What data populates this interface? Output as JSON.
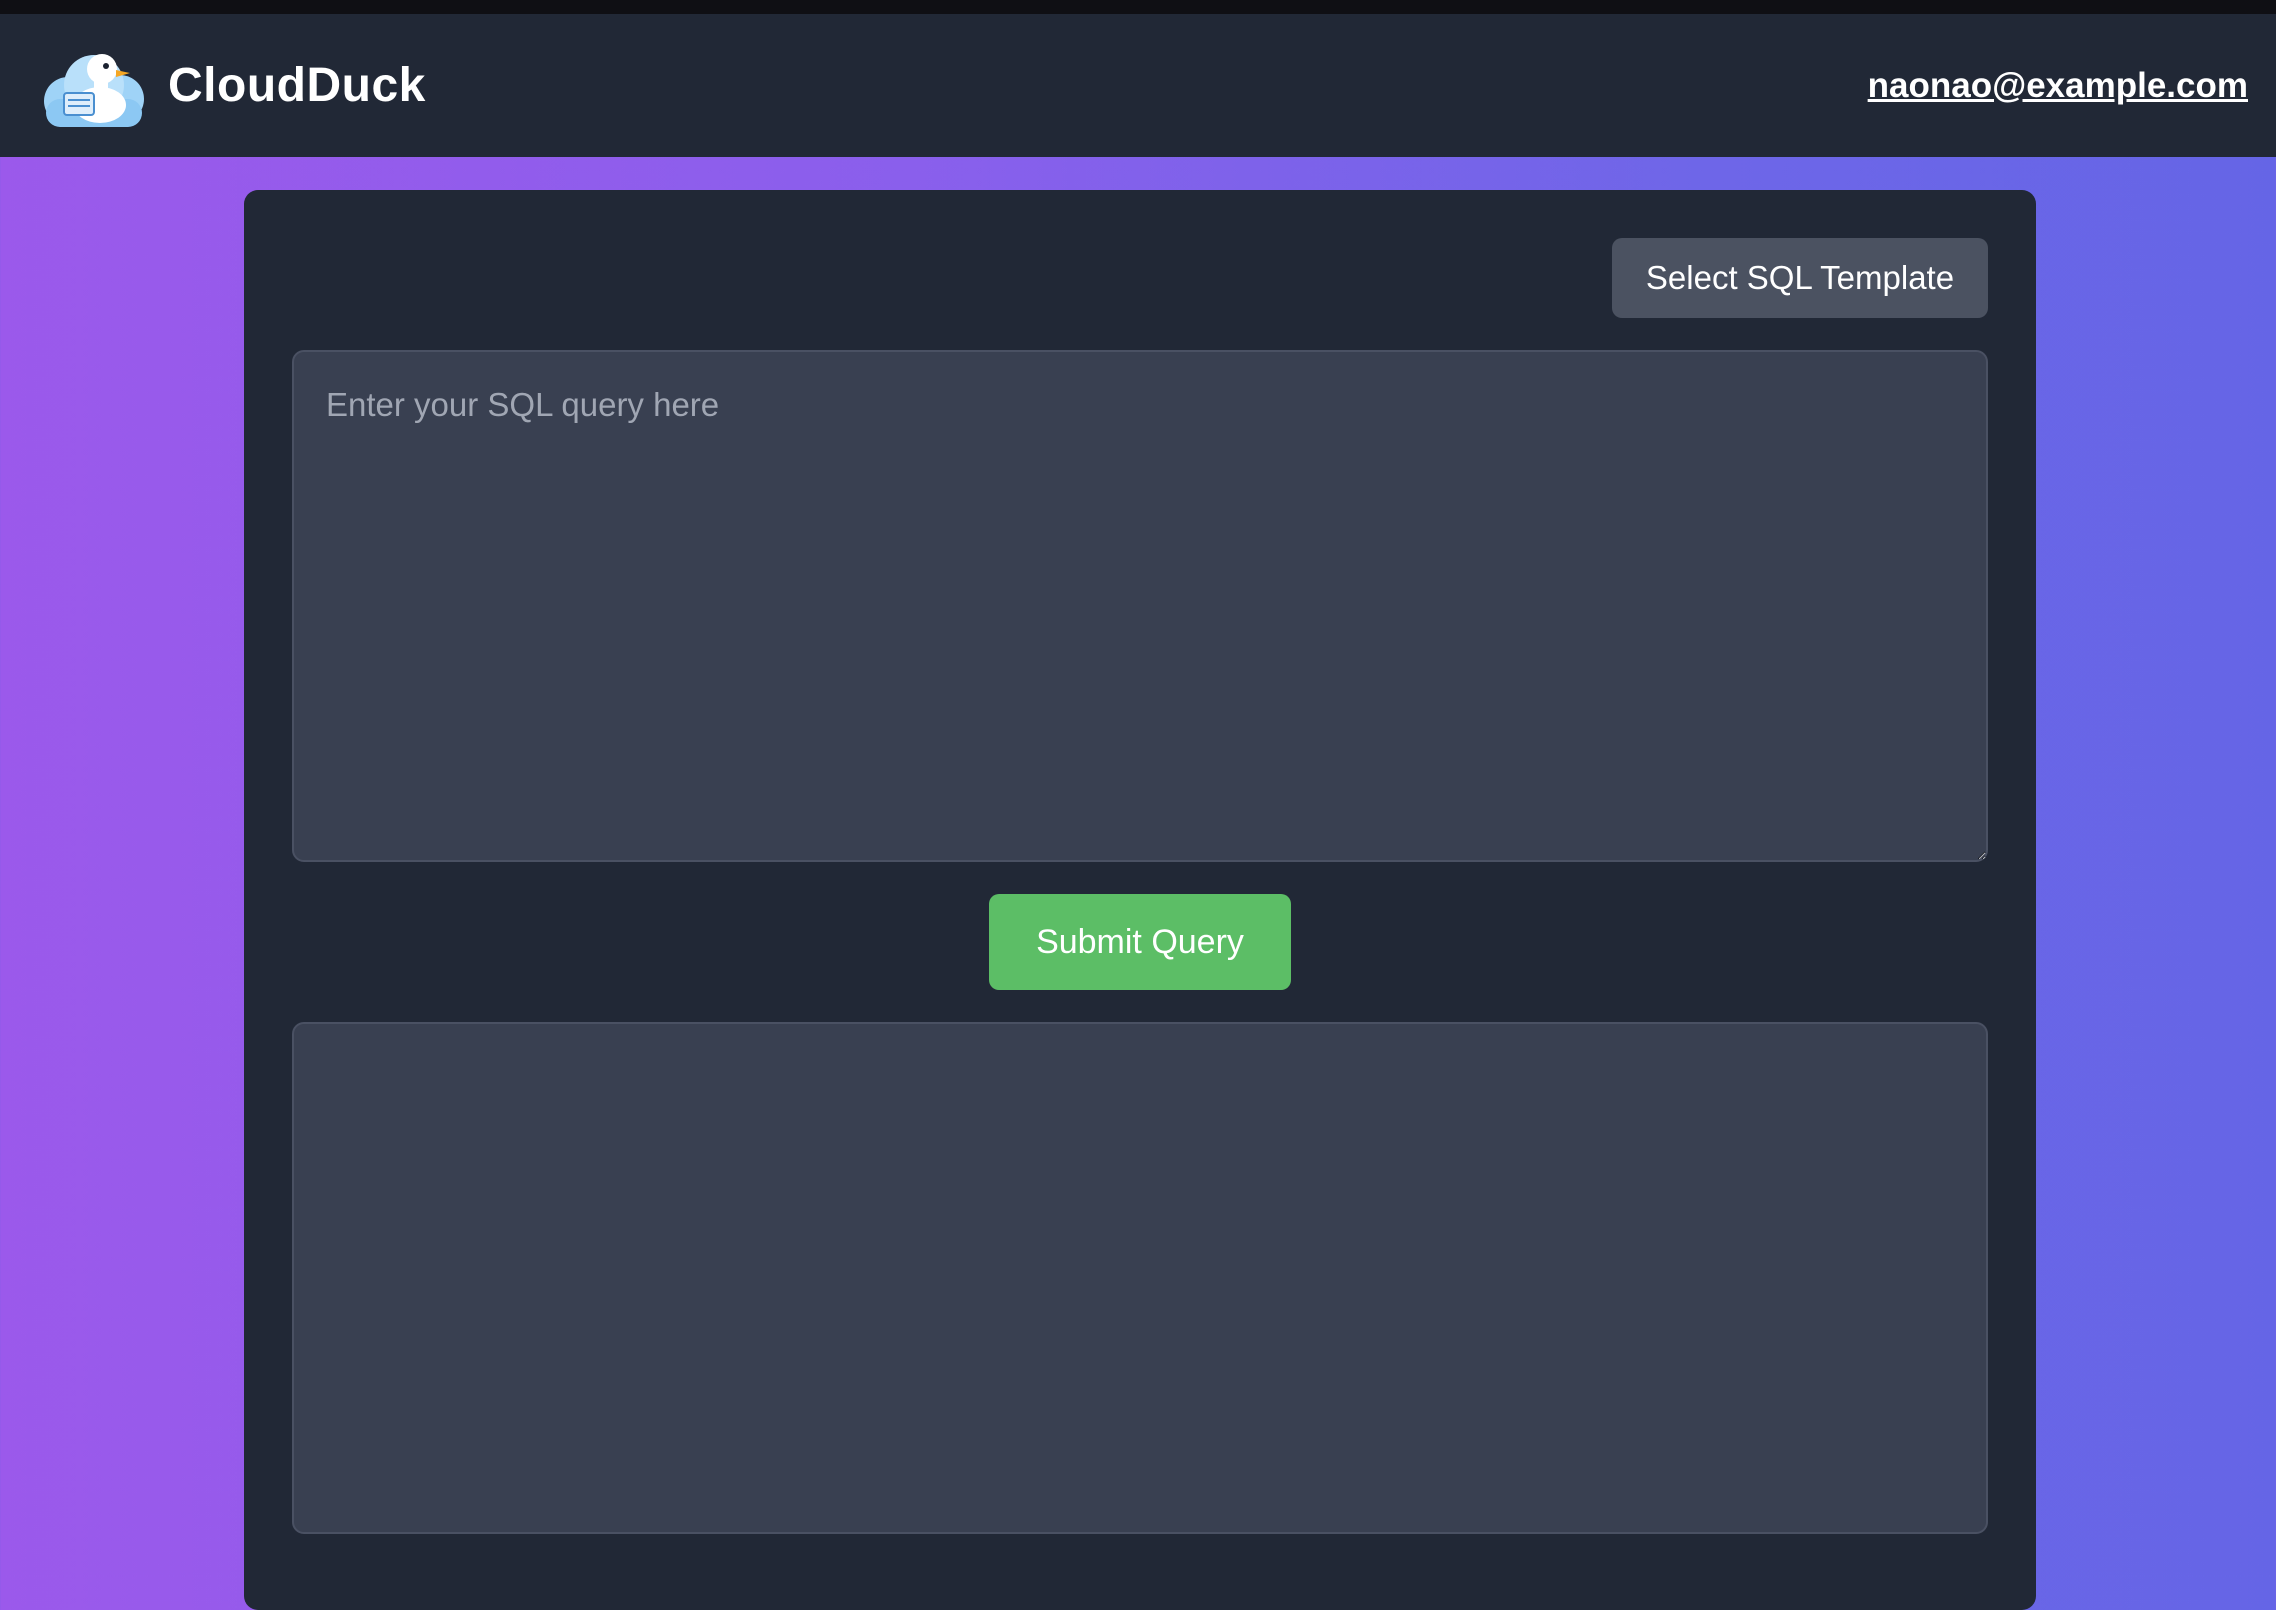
{
  "app": {
    "brand_name": "CloudDuck",
    "logo_icon": "cloud-duck-logo-icon"
  },
  "header": {
    "user_email": "naonao@example.com"
  },
  "editor": {
    "template_button_label": "Select SQL Template",
    "query_placeholder": "Enter your SQL query here",
    "query_value": "",
    "submit_label": "Submit Query"
  },
  "results": {
    "content": ""
  },
  "colors": {
    "navbar": "#212836",
    "panel": "#212836",
    "input_bg": "#394051",
    "submit_green": "#5cbe66",
    "template_button": "#4b5261",
    "gradient_start": "#9b59eb",
    "gradient_end": "#6565e6"
  }
}
